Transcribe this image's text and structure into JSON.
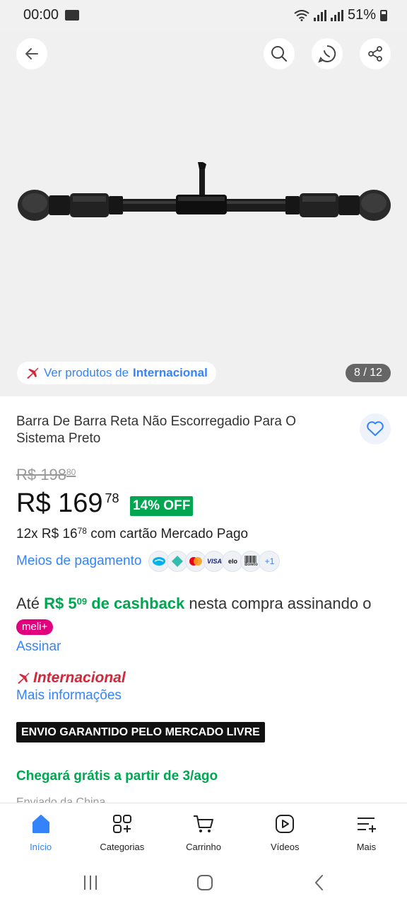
{
  "status": {
    "time": "00:00",
    "battery": "51%"
  },
  "gallery": {
    "intl_prefix": "Ver produtos de ",
    "intl_bold": "Internacional",
    "counter": "8 / 12"
  },
  "product": {
    "title": "Barra De Barra Reta Não Escorregadio Para O Sistema Preto",
    "old_price_main": "R$ 198",
    "old_price_cents": "80",
    "price_main": "R$ 169",
    "price_cents": "78",
    "discount": "14% OFF",
    "installments_prefix": "12x R$ 16",
    "installments_cents": "78",
    "installments_suffix": " com cartão Mercado Pago",
    "payment_link": "Meios de pagamento",
    "payment_icons": [
      "mercado-pago",
      "pix",
      "mastercard",
      "VISA",
      "elo",
      "Boleto"
    ],
    "payment_more": "+1"
  },
  "cashback": {
    "prefix": "Até ",
    "amount_main": "R$ 5",
    "amount_cents": "09",
    "amount_suffix": " de cashback",
    "rest": " nesta compra assinando o ",
    "badge": "meli+",
    "cta": "Assinar"
  },
  "international": {
    "title": "Internacional",
    "link": "Mais informações"
  },
  "shipping": {
    "banner": "ENVIO GARANTIDO PELO MERCADO LIVRE",
    "arrival": "Chegará grátis a partir de 3/ago",
    "partial": "Enviado da China"
  },
  "nav": {
    "items": [
      {
        "label": "Início",
        "icon": "home-icon"
      },
      {
        "label": "Categorias",
        "icon": "categories-icon"
      },
      {
        "label": "Carrinho",
        "icon": "cart-icon"
      },
      {
        "label": "Vídeos",
        "icon": "video-icon"
      },
      {
        "label": "Mais",
        "icon": "menu-icon"
      }
    ]
  },
  "colors": {
    "blue": "#3483fa",
    "green": "#00a650",
    "red": "#d3273a",
    "pink": "#e3007f"
  }
}
